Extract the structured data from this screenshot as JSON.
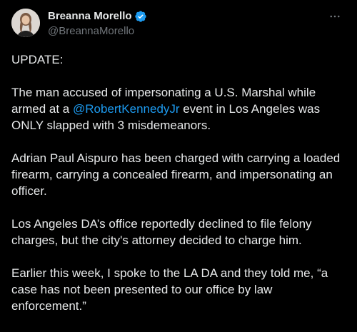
{
  "author": {
    "display_name": "Breanna Morello",
    "handle": "@BreannaMorello",
    "verified": true
  },
  "tweet": {
    "p1": "UPDATE:",
    "p2_a": "The man accused of impersonating a U.S. Marshal while",
    "p2_b_pre": "armed at a ",
    "p2_b_mention": "@RobertKennedyJr",
    "p2_b_post": " event in Los Angeles was",
    "p2_c": "ONLY slapped with 3 misdemeanors.",
    "p3_a": "Adrian Paul Aispuro has been charged with carrying a loaded",
    "p3_b": "firearm, carrying a concealed firearm, and impersonating an",
    "p3_c": "officer.",
    "p4_a": "Los Angeles DA’s office reportedly declined to file felony",
    "p4_b": "charges, but the city's attorney decided to charge him.",
    "p5_a": "Earlier this week, I spoke to the LA DA and they told me, “a",
    "p5_b": "case has not been presented to our office by law",
    "p5_c": "enforcement.”"
  },
  "icons": {
    "verified": "verified-badge-icon",
    "more": "more-options-icon"
  },
  "colors": {
    "background": "#000000",
    "text": "#e7e9ea",
    "secondary_text": "#71767b",
    "link": "#1d9bf0",
    "verified": "#1d9bf0"
  }
}
